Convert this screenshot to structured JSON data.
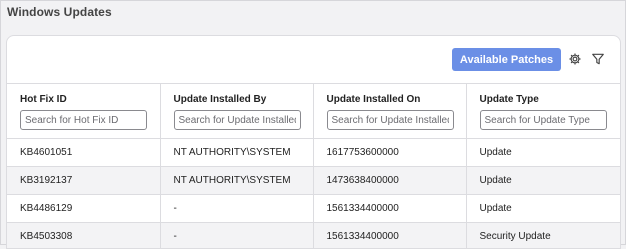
{
  "panel": {
    "title": "Windows Updates"
  },
  "toolbar": {
    "available_patches_label": "Available Patches",
    "settings_icon": "gear-icon",
    "filter_icon": "funnel-icon"
  },
  "columns": [
    {
      "label": "Hot Fix ID",
      "placeholder": "Search for Hot Fix ID"
    },
    {
      "label": "Update Installed By",
      "placeholder": "Search for Update Installed By"
    },
    {
      "label": "Update Installed On",
      "placeholder": "Search for Update Installed On"
    },
    {
      "label": "Update Type",
      "placeholder": "Search for Update Type"
    }
  ],
  "rows": [
    [
      "KB4601051",
      "NT AUTHORITY\\SYSTEM",
      "1617753600000",
      "Update"
    ],
    [
      "KB3192137",
      "NT AUTHORITY\\SYSTEM",
      "1473638400000",
      "Update"
    ],
    [
      "KB4486129",
      "-",
      "1561334400000",
      "Update"
    ],
    [
      "KB4503308",
      "-",
      "1561334400000",
      "Security Update"
    ]
  ],
  "colors": {
    "primary_button": "#6b8fe6",
    "row_alt": "#f3f3f5"
  }
}
